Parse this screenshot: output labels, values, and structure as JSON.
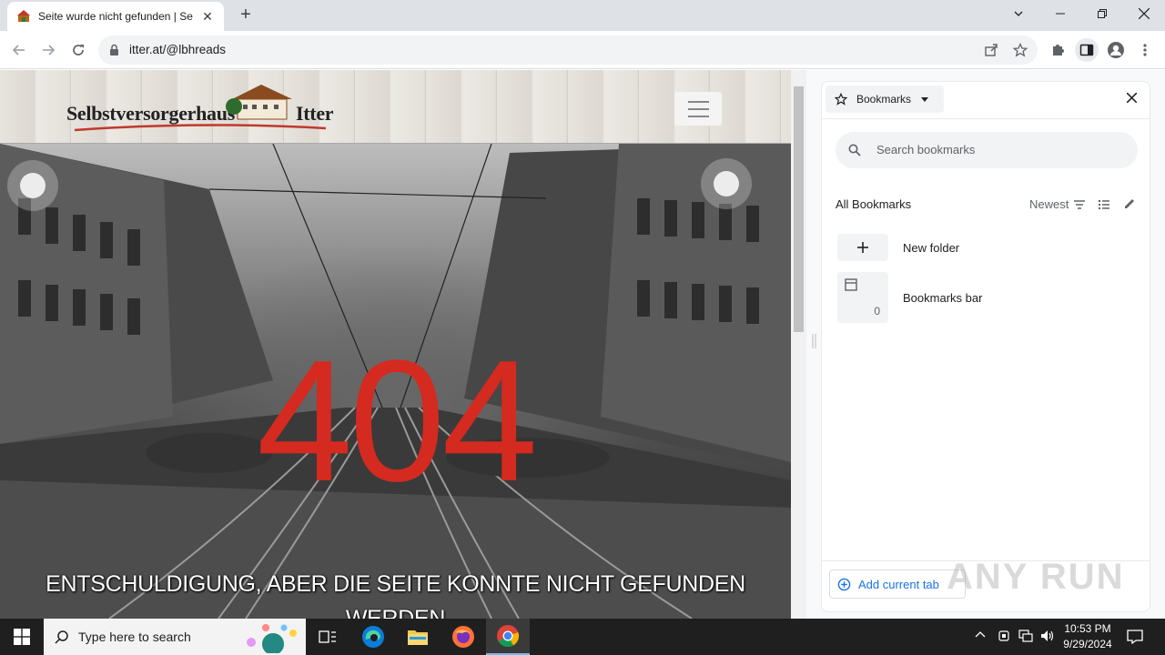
{
  "browser": {
    "tab_title": "Seite wurde nicht gefunden | Sel",
    "tab_close": "✕",
    "new_tab": "+",
    "url": "itter.at/@lbhreads"
  },
  "site": {
    "logo_left": "Selbstversorgerhaus",
    "logo_right": "Itter",
    "error_code": "404",
    "error_message": "ENTSCHULDIGUNG, ABER DIE SEITE KONNTE NICHT GEFUNDEN WERDEN"
  },
  "side_panel": {
    "title": "Bookmarks",
    "search_placeholder": "Search bookmarks",
    "all_bookmarks": "All Bookmarks",
    "sort_label": "Newest",
    "new_folder": "New folder",
    "bookmarks_bar": "Bookmarks bar",
    "bookmarks_bar_count": "0",
    "add_current_tab": "Add current tab",
    "watermark": "ANY RUN"
  },
  "taskbar": {
    "search_placeholder": "Type here to search",
    "time": "10:53 PM",
    "date": "9/29/2024"
  },
  "colors": {
    "error_red": "#d42a20",
    "link_blue": "#1a73e8",
    "taskbar": "#1f1f1f"
  }
}
